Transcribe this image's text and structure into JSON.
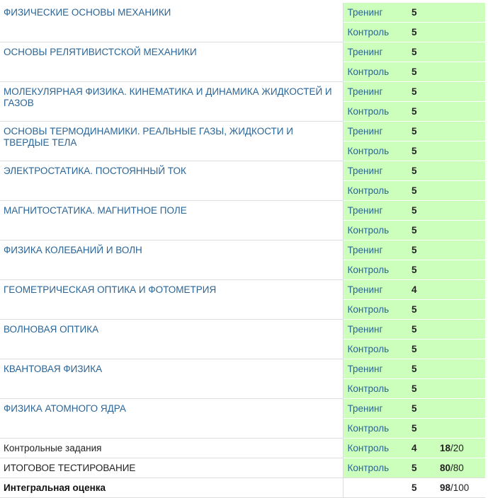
{
  "sections": [
    {
      "title": "ФИЗИЧЕСКИЕ ОСНОВЫ МЕХАНИКИ",
      "rows": [
        {
          "type": "Тренинг",
          "score": "5"
        },
        {
          "type": "Контроль",
          "score": "5"
        }
      ]
    },
    {
      "title": "ОСНОВЫ РЕЛЯТИВИСТСКОЙ МЕХАНИКИ",
      "rows": [
        {
          "type": "Тренинг",
          "score": "5"
        },
        {
          "type": "Контроль",
          "score": "5"
        }
      ]
    },
    {
      "title": "МОЛЕКУЛЯРНАЯ ФИЗИКА. КИНЕМАТИКА И ДИНАМИКА ЖИДКОСТЕЙ И ГАЗОВ",
      "rows": [
        {
          "type": "Тренинг",
          "score": "5"
        },
        {
          "type": "Контроль",
          "score": "5"
        }
      ]
    },
    {
      "title": "ОСНОВЫ ТЕРМОДИНАМИКИ. РЕАЛЬНЫЕ ГАЗЫ, ЖИДКОСТИ И ТВЕРДЫЕ ТЕЛА",
      "rows": [
        {
          "type": "Тренинг",
          "score": "5"
        },
        {
          "type": "Контроль",
          "score": "5"
        }
      ]
    },
    {
      "title": "ЭЛЕКТРОСТАТИКА. ПОСТОЯННЫЙ ТОК",
      "rows": [
        {
          "type": "Тренинг",
          "score": "5"
        },
        {
          "type": "Контроль",
          "score": "5"
        }
      ]
    },
    {
      "title": "МАГНИТОСТАТИКА. МАГНИТНОЕ ПОЛЕ",
      "rows": [
        {
          "type": "Тренинг",
          "score": "5"
        },
        {
          "type": "Контроль",
          "score": "5"
        }
      ]
    },
    {
      "title": "ФИЗИКА КОЛЕБАНИЙ И ВОЛН",
      "rows": [
        {
          "type": "Тренинг",
          "score": "5"
        },
        {
          "type": "Контроль",
          "score": "5"
        }
      ]
    },
    {
      "title": "ГЕОМЕТРИЧЕСКАЯ ОПТИКА И ФОТОМЕТРИЯ",
      "rows": [
        {
          "type": "Тренинг",
          "score": "4"
        },
        {
          "type": "Контроль",
          "score": "5"
        }
      ]
    },
    {
      "title": "ВОЛНОВАЯ ОПТИКА",
      "rows": [
        {
          "type": "Тренинг",
          "score": "5"
        },
        {
          "type": "Контроль",
          "score": "5"
        }
      ]
    },
    {
      "title": "КВАНТОВАЯ ФИЗИКА",
      "rows": [
        {
          "type": "Тренинг",
          "score": "5"
        },
        {
          "type": "Контроль",
          "score": "5"
        }
      ]
    },
    {
      "title": "ФИЗИКА АТОМНОГО ЯДРА",
      "rows": [
        {
          "type": "Тренинг",
          "score": "5"
        },
        {
          "type": "Контроль",
          "score": "5"
        }
      ]
    }
  ],
  "summary_rows": [
    {
      "title": "Контрольные задания",
      "type": "Контроль",
      "score": "4",
      "points": "18",
      "max": "/20"
    },
    {
      "title": "ИТОГОВОЕ ТЕСТИРОВАНИЕ",
      "type": "Контроль",
      "score": "5",
      "points": "80",
      "max": "/80"
    }
  ],
  "total": {
    "title": "Интегральная оценка",
    "score": "5",
    "points": "98",
    "max": "/100"
  },
  "colors": {
    "link": "#2a6496",
    "passed_background": "#ccffbb",
    "border": "#dddddd"
  }
}
